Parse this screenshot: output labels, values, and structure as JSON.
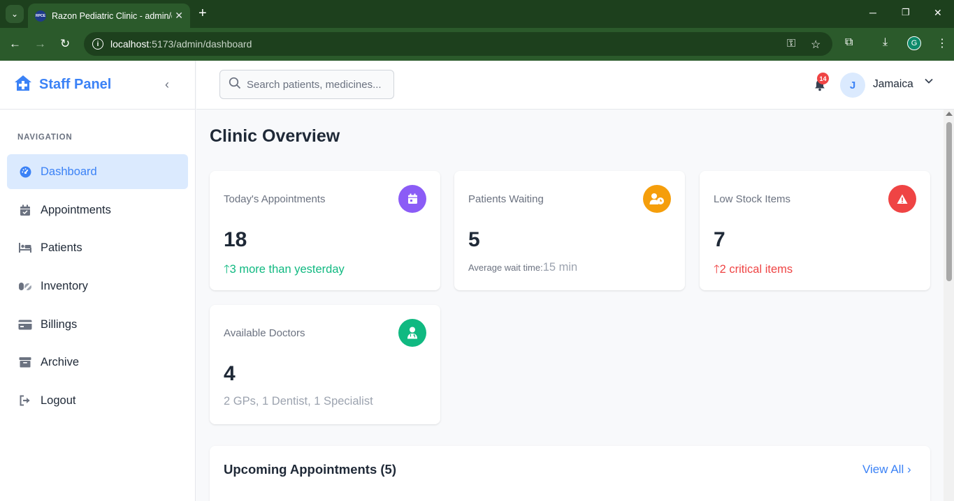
{
  "browser": {
    "tab_title": "Razon Pediatric Clinic - admin/dashboard",
    "favicon_text": "RPCE",
    "url_host": "localhost",
    "url_path": ":5173/admin/dashboard",
    "profile_initial": "G"
  },
  "sidebar": {
    "brand": "Staff Panel",
    "nav_heading": "NAVIGATION",
    "items": [
      {
        "label": "Dashboard",
        "icon": "gauge-icon",
        "active": true
      },
      {
        "label": "Appointments",
        "icon": "calendar-check-icon"
      },
      {
        "label": "Patients",
        "icon": "bed-patient-icon"
      },
      {
        "label": "Inventory",
        "icon": "pills-icon"
      },
      {
        "label": "Billings",
        "icon": "credit-card-icon"
      },
      {
        "label": "Archive",
        "icon": "archive-box-icon"
      },
      {
        "label": "Logout",
        "icon": "logout-icon"
      }
    ]
  },
  "topbar": {
    "search_placeholder": "Search patients, medicines...",
    "notification_count": "14",
    "user_initial": "J",
    "user_name": "Jamaica"
  },
  "main": {
    "title": "Clinic Overview",
    "cards": [
      {
        "label": "Today's Appointments",
        "value": "18",
        "sub": "3 more than yesterday",
        "icon": "calendar-icon",
        "color": "#8b5cf6"
      },
      {
        "label": "Patients Waiting",
        "value": "5",
        "sub_prefix": "Average wait time:",
        "sub": "15 min",
        "icon": "user-clock-icon",
        "color": "#f59e0b"
      },
      {
        "label": "Low Stock Items",
        "value": "7",
        "sub": "2 critical items",
        "icon": "warning-icon",
        "color": "#ef4444"
      },
      {
        "label": "Available Doctors",
        "value": "4",
        "sub": "2 GPs, 1 Dentist, 1 Specialist",
        "icon": "doctor-icon",
        "color": "#10b981"
      }
    ],
    "upcoming": {
      "title": "Upcoming Appointments (5)",
      "view_all": "View All"
    }
  },
  "colors": {
    "primary": "#3b82f6",
    "success": "#10b981",
    "danger": "#ef4444",
    "browser_frame": "#1d401d"
  }
}
